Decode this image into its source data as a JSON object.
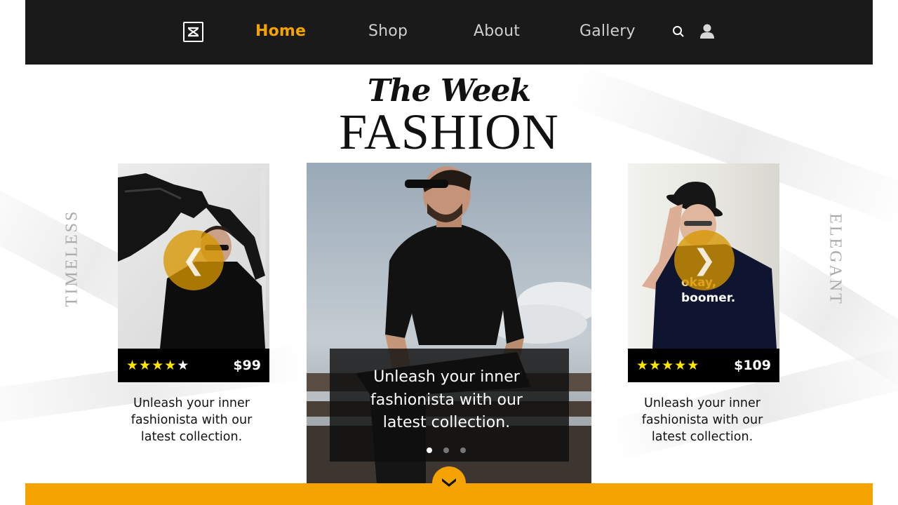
{
  "nav": {
    "logo_icon": "brand-logo-icon",
    "links": [
      {
        "label": "Home",
        "active": true
      },
      {
        "label": "Shop",
        "active": false
      },
      {
        "label": "About",
        "active": false
      },
      {
        "label": "Gallery",
        "active": false
      }
    ],
    "search_icon": "search-icon",
    "user_icon": "user-icon"
  },
  "hero_title": {
    "script": "The Week",
    "main": "FASHION"
  },
  "side_words": {
    "left": "TIMELESS",
    "right": "ELEGANT"
  },
  "cards": [
    {
      "rating": 4,
      "rating_max": 5,
      "price": "$99",
      "caption_lines": [
        "Unleash your inner",
        "fashionista with our",
        "latest collection."
      ]
    },
    {
      "rating": 5,
      "rating_max": 5,
      "price": "$109",
      "shirt_text": "okay, boomer.",
      "caption_lines": [
        "Unleash your inner",
        "fashionista with our",
        "latest collection."
      ]
    }
  ],
  "featured": {
    "text_lines": [
      "Unleash your inner",
      "fashionista with our",
      "latest collection."
    ],
    "slide_count": 3,
    "active_slide": 1
  },
  "controls": {
    "prev_icon": "chevron-left-icon",
    "prev_glyph": "❮",
    "next_icon": "chevron-right-icon",
    "next_glyph": "❯",
    "scroll_icon": "chevron-down-icon"
  },
  "colors": {
    "accent": "#f5a300",
    "nav_bg": "#1a1a1a",
    "star": "#ffe600",
    "text": "#111111"
  }
}
